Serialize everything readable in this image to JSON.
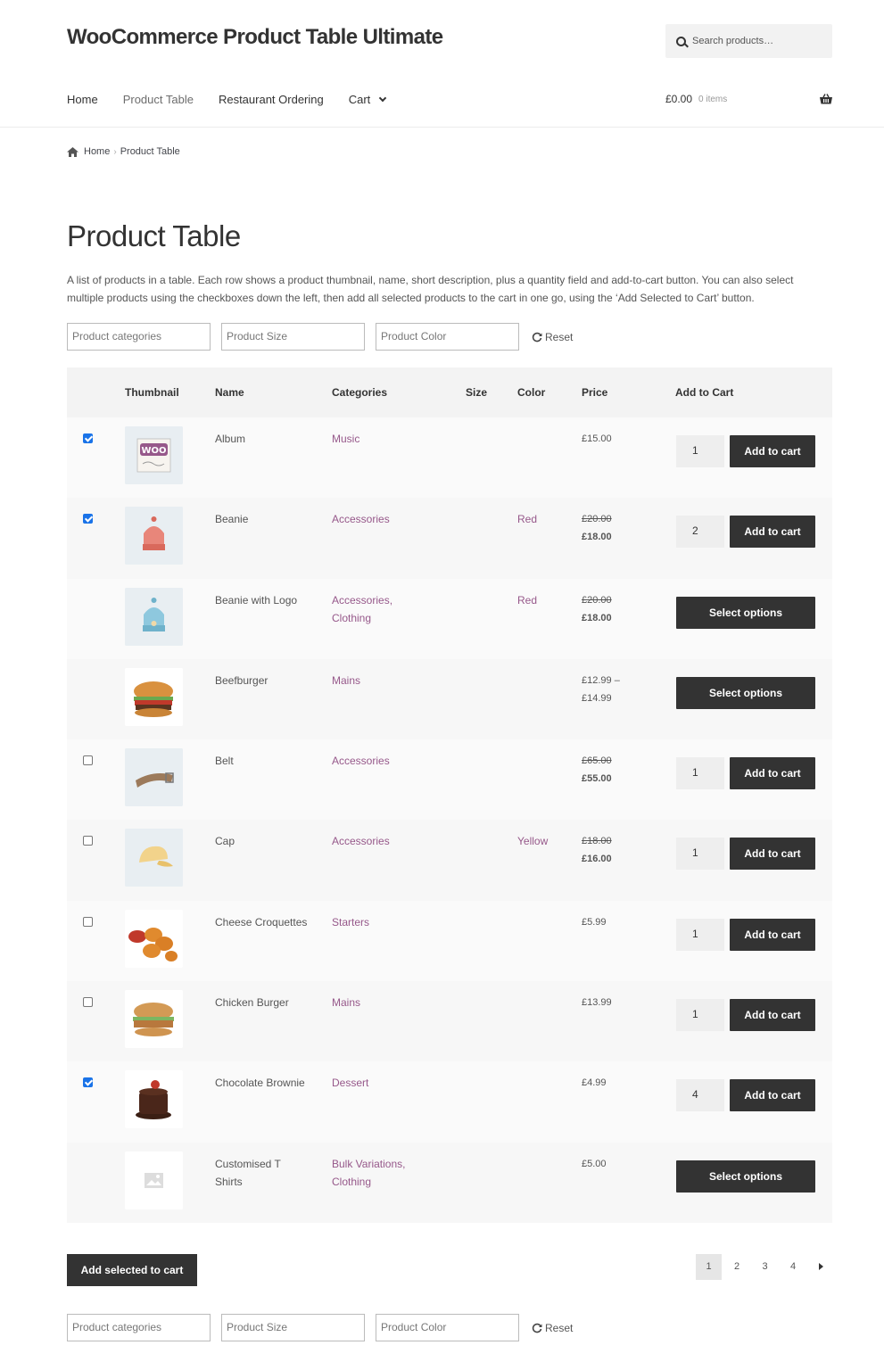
{
  "site": {
    "title": "WooCommerce Product Table Ultimate",
    "search_placeholder": "Search products…"
  },
  "nav": {
    "items": [
      {
        "label": "Home",
        "current": false
      },
      {
        "label": "Product Table",
        "current": true
      },
      {
        "label": "Restaurant Ordering",
        "current": false
      },
      {
        "label": "Cart",
        "current": false,
        "has_dropdown": true
      }
    ]
  },
  "mini_cart": {
    "amount": "£0.00",
    "count": "0 items"
  },
  "breadcrumb": {
    "home": "Home",
    "current": "Product Table"
  },
  "page": {
    "title": "Product Table",
    "intro": "A list of products in a table. Each row shows a product thumbnail, name, short description, plus a quantity field and add-to-cart button. You can also select multiple products using the checkboxes down the left, then add all selected products to the cart in one go, using the ‘Add Selected to Cart’ button."
  },
  "filters": {
    "categories": "Product categories",
    "size": "Product Size",
    "color": "Product Color",
    "reset": "Reset"
  },
  "table": {
    "headers": {
      "thumbnail": "Thumbnail",
      "name": "Name",
      "categories": "Categories",
      "size": "Size",
      "color": "Color",
      "price": "Price",
      "add_to_cart": "Add to Cart"
    },
    "rows": [
      {
        "name": "Album",
        "categories": "Music",
        "color": "",
        "price": "£15.00",
        "price_old": "",
        "checked": true,
        "qty": "1",
        "button": "Add to cart",
        "thumb": "album"
      },
      {
        "name": "Beanie",
        "categories": "Accessories",
        "color": "Red",
        "price": "£18.00",
        "price_old": "£20.00",
        "checked": true,
        "qty": "2",
        "button": "Add to cart",
        "thumb": "beanie-red"
      },
      {
        "name": "Beanie with Logo",
        "categories": "Accessories,\nClothing",
        "color": "Red",
        "price": "£18.00",
        "price_old": "£20.00",
        "checked": null,
        "qty": "",
        "button": "Select options",
        "thumb": "beanie-blue"
      },
      {
        "name": "Beefburger",
        "categories": "Mains",
        "color": "",
        "price": "£12.99 –\n£14.99",
        "price_old": "",
        "checked": null,
        "qty": "",
        "button": "Select options",
        "thumb": "burger"
      },
      {
        "name": "Belt",
        "categories": "Accessories",
        "color": "",
        "price": "£55.00",
        "price_old": "£65.00",
        "checked": false,
        "qty": "1",
        "button": "Add to cart",
        "thumb": "belt"
      },
      {
        "name": "Cap",
        "categories": "Accessories",
        "color": "Yellow",
        "price": "£16.00",
        "price_old": "£18.00",
        "checked": false,
        "qty": "1",
        "button": "Add to cart",
        "thumb": "cap"
      },
      {
        "name": "Cheese Croquettes",
        "categories": "Starters",
        "color": "",
        "price": "£5.99",
        "price_old": "",
        "checked": false,
        "qty": "1",
        "button": "Add to cart",
        "thumb": "croquettes"
      },
      {
        "name": "Chicken Burger",
        "categories": "Mains",
        "color": "",
        "price": "£13.99",
        "price_old": "",
        "checked": false,
        "qty": "1",
        "button": "Add to cart",
        "thumb": "chicken-burger"
      },
      {
        "name": "Chocolate Brownie",
        "categories": "Dessert",
        "color": "",
        "price": "£4.99",
        "price_old": "",
        "checked": true,
        "qty": "4",
        "button": "Add to cart",
        "thumb": "brownie"
      },
      {
        "name": "Customised T Shirts",
        "categories": "Bulk Variations,\nClothing",
        "color": "",
        "price": "£5.00",
        "price_old": "",
        "checked": null,
        "qty": "",
        "button": "Select options",
        "thumb": "placeholder"
      }
    ]
  },
  "add_selected": "Add selected to cart",
  "pagination": {
    "pages": [
      "1",
      "2",
      "3",
      "4"
    ],
    "active": "1"
  },
  "colors": {
    "accent": "#96588a",
    "button": "#333333",
    "checkbox": "#1a73e8"
  }
}
